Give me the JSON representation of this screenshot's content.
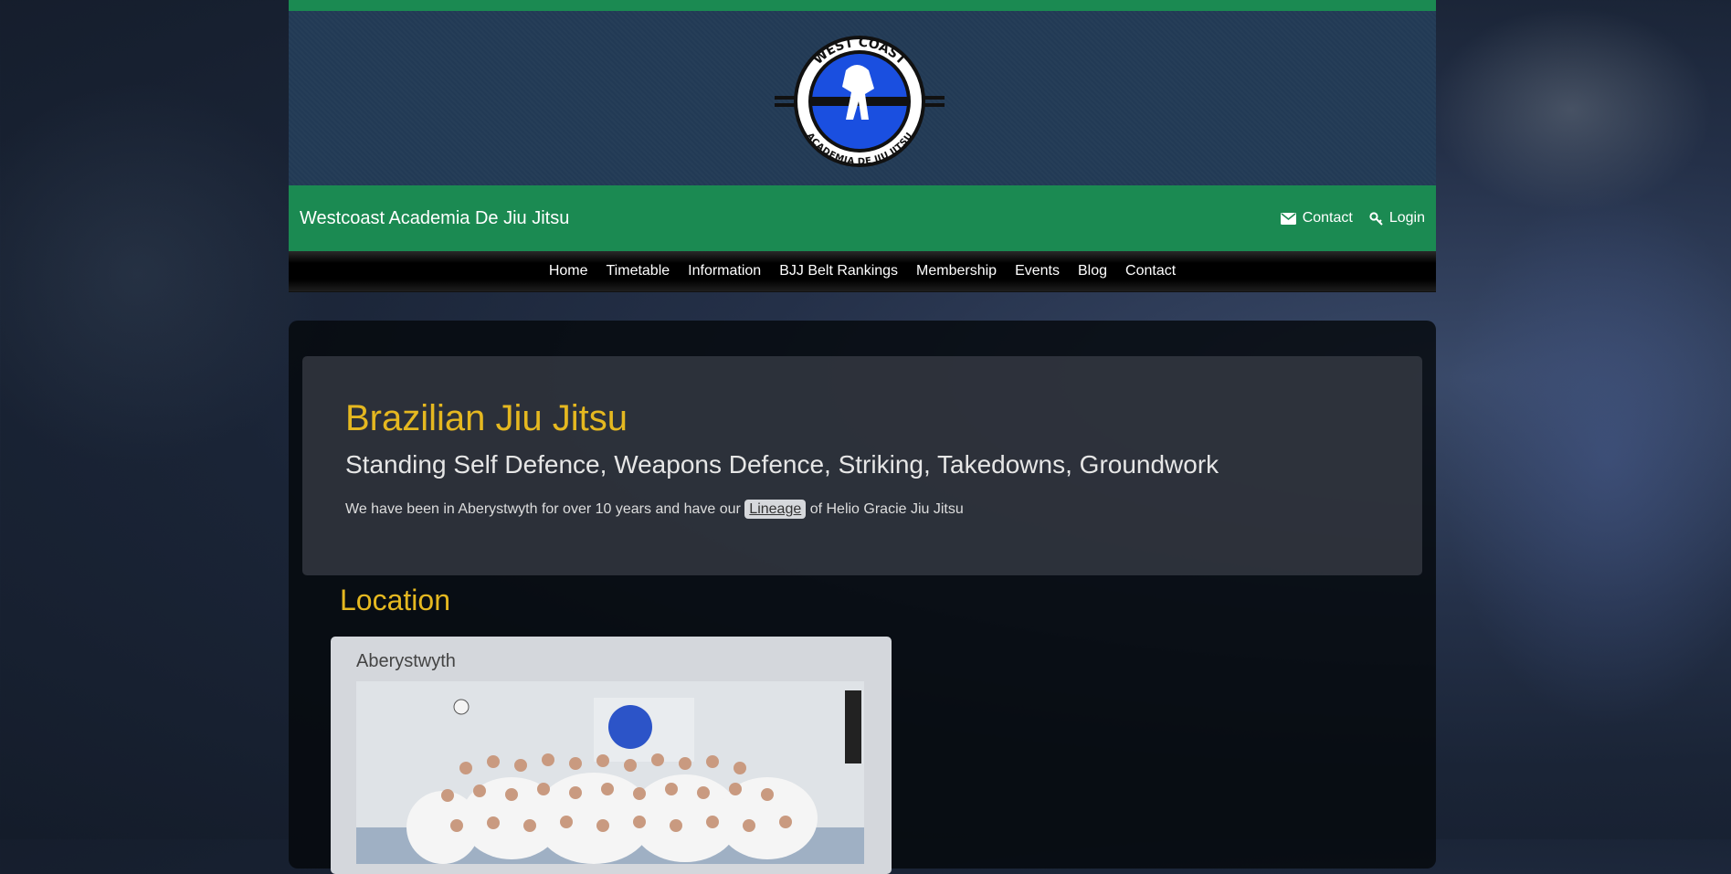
{
  "site": {
    "name": "Westcoast Academia De Jiu Jitsu",
    "logo_top_text": "WEST COAST",
    "logo_bottom_text": "ACADEMIA DE JIU JITSU"
  },
  "header_nav": [
    {
      "label": "Contact",
      "icon": "envelope-icon"
    },
    {
      "label": "Login",
      "icon": "key-icon"
    }
  ],
  "menu": [
    "Home",
    "Timetable",
    "Information",
    "BJJ Belt Rankings",
    "Membership",
    "Events",
    "Blog",
    "Contact"
  ],
  "hero": {
    "title": "Brazilian Jiu Jitsu",
    "subtitle": "Standing Self Defence, Weapons Defence, Striking, Takedowns, Groundwork",
    "text_before": "We have been in Aberystwyth for over 10 years and have our",
    "link": "Lineage",
    "text_after": "of Helio Gracie Jiu Jitsu"
  },
  "location": {
    "heading": "Location",
    "card_title": "Aberystwyth"
  },
  "colors": {
    "brand_green": "#1b8a52",
    "banner_blue": "#223a55",
    "heading_gold": "#e5b820"
  }
}
